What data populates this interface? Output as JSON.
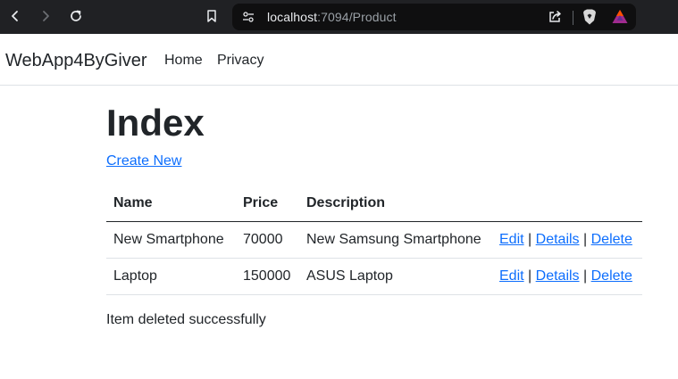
{
  "browser": {
    "url_host": "localhost",
    "url_path": ":7094/Product",
    "icons": [
      "back-icon",
      "forward-icon",
      "reload-icon",
      "bookmark-icon",
      "site-settings-icon",
      "share-icon",
      "brave-shield-icon",
      "brave-rewards-icon"
    ]
  },
  "navbar": {
    "brand": "WebApp4ByGiver",
    "links": [
      "Home",
      "Privacy"
    ]
  },
  "page": {
    "title": "Index",
    "create_link": "Create New",
    "message": "Item deleted successfully"
  },
  "table": {
    "headers": [
      "Name",
      "Price",
      "Description",
      ""
    ],
    "rows": [
      {
        "name": "New Smartphone",
        "price": "70000",
        "description": "New Samsung Smartphone"
      },
      {
        "name": "Laptop",
        "price": "150000",
        "description": "ASUS Laptop"
      }
    ],
    "actions": {
      "edit": "Edit",
      "details": "Details",
      "delete": "Delete",
      "sep": "|"
    }
  },
  "colors": {
    "link": "#0d6efd",
    "chrome_bg": "#202124",
    "address_bg": "#0f0f10"
  }
}
